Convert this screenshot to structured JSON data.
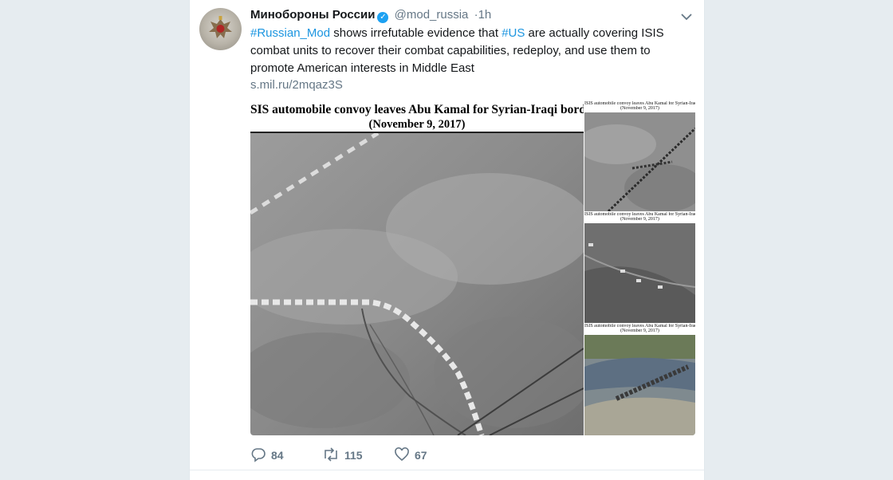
{
  "tweet": {
    "author_name": "Минобороны России",
    "handle": "@mod_russia",
    "separator": "·",
    "time": "1h",
    "text_segments": [
      {
        "text": "#Russian_Mod",
        "type": "hashtag"
      },
      {
        "text": " shows irrefutable evidence that ",
        "type": "text"
      },
      {
        "text": "#US",
        "type": "hashtag"
      },
      {
        "text": " are actually covering ISIS combat units to recover their combat capabilities, redeploy, and use them to promote American interests in Middle East",
        "type": "text"
      }
    ],
    "link": "s.mil.ru/2mqaz3S"
  },
  "media": {
    "main_caption_line1": "SIS automobile convoy leaves Abu Kamal for Syrian-Iraqi bord",
    "main_caption_line2": "(November 9, 2017)",
    "thumbs": [
      {
        "caption1": "ISIS automobile convoy leaves Abu Kamal for Syrian-Iraqi bord",
        "caption2": "(November 9, 2017)"
      },
      {
        "caption1": "ISIS automobile convoy leaves Abu Kamal for Syrian-Iraqi bord",
        "caption2": "(November 9, 2017)"
      },
      {
        "caption1": "ISIS automobile convoy leaves Abu Kamal for Syrian-Iraqi bord",
        "caption2": "(November 9, 2017)"
      }
    ]
  },
  "actions": {
    "reply_count": "84",
    "retweet_count": "115",
    "like_count": "67"
  },
  "colors": {
    "accent": "#1da1f2",
    "hashtag": "#1b95e0",
    "muted": "#657786",
    "page_bg": "#e6ecf0"
  },
  "icons": [
    "verified-badge-icon",
    "caret-down-icon",
    "reply-icon",
    "retweet-icon",
    "like-icon"
  ]
}
